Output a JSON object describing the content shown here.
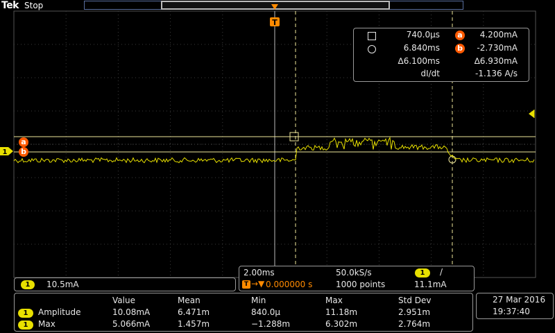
{
  "header": {
    "brand": "Tek",
    "acq_state": "Stop"
  },
  "colors": {
    "trace": "#e8e000",
    "cursor": "#f0e89a",
    "accent": "#ff5a00",
    "grid": "#4a4a4a",
    "axis": "#8a8a8a"
  },
  "trigger": {
    "marker_label": "T"
  },
  "cursor_readout": {
    "a_time": "740.0µs",
    "a_label": "a",
    "a_value": "4.200mA",
    "b_time": "6.840ms",
    "b_label": "b",
    "b_value": "-2.730mA",
    "delta_time": "∆6.100ms",
    "delta_value": "∆6.930mA",
    "slope_label": "dI/dt",
    "slope_value": "-1.136 A/s"
  },
  "channel": {
    "number": "1",
    "scale": "10.5mA"
  },
  "timebase": {
    "horizontal_scale": "2.00ms",
    "sample_rate": "50.0kS/s",
    "trigger_channel": "1",
    "trigger_slope": "/",
    "trigger_position": "0.000000 s",
    "record_length": "1000 points",
    "trigger_level": "11.1mA"
  },
  "measurements": {
    "headers": [
      "Value",
      "Mean",
      "Min",
      "Max",
      "Std Dev"
    ],
    "rows": [
      {
        "channel": "1",
        "name": "Amplitude",
        "value": "10.08mA",
        "mean": "6.471m",
        "min": "840.0µ",
        "max": "11.18m",
        "std": "2.951m"
      },
      {
        "channel": "1",
        "name": "Max",
        "value": "5.066mA",
        "mean": "1.457m",
        "min": "−1.288m",
        "max": "6.302m",
        "std": "2.764m"
      }
    ]
  },
  "datetime": {
    "date": "27 Mar  2016",
    "time": "19:37:40"
  }
}
